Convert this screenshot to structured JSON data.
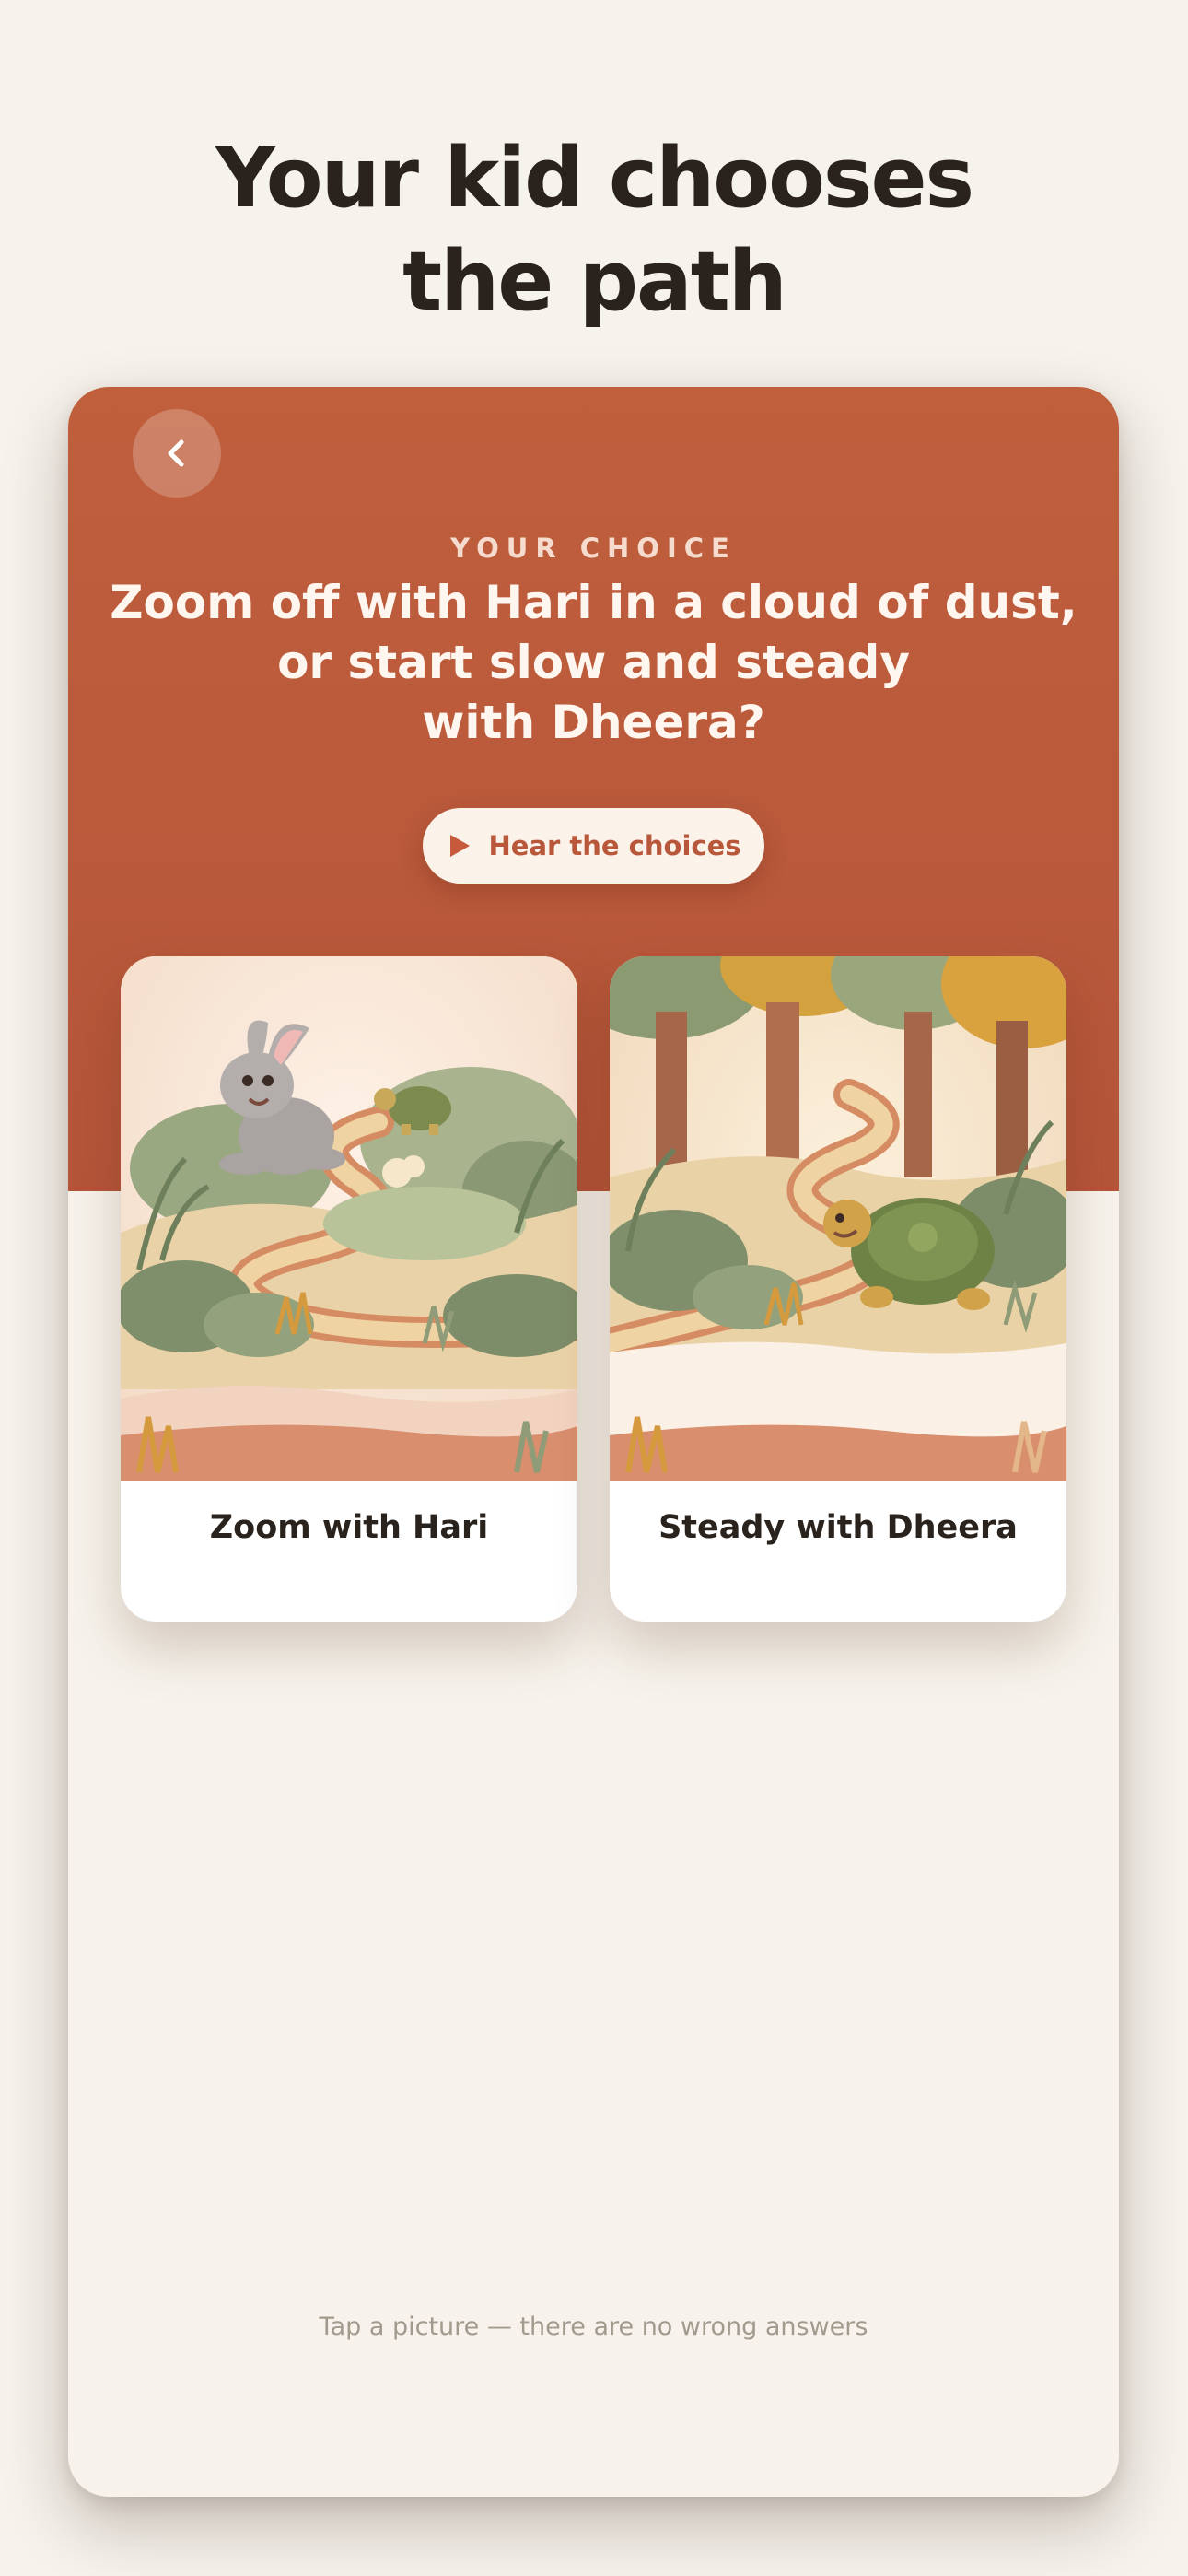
{
  "headline": {
    "line1": "Your kid chooses",
    "line2": "the path"
  },
  "screen": {
    "back_icon": "chevron-left-icon",
    "eyebrow": "YOUR CHOICE",
    "question": {
      "line1": "Zoom off with Hari in a cloud of dust,",
      "line2": "or start slow and steady",
      "line3": "with Dheera?"
    },
    "hear_button": {
      "icon": "play-icon",
      "label": "Hear the choices"
    },
    "choices": [
      {
        "label": "Zoom with Hari",
        "illustration": "rabbit-running-on-path"
      },
      {
        "label": "Steady with Dheera",
        "illustration": "tortoise-walking-on-path"
      }
    ],
    "hint": "Tap a picture — there are no wrong answers"
  },
  "colors": {
    "page_bg": "#f6f2ec",
    "accent": "#c05f3c",
    "text_dark": "#2a231d",
    "hint": "#a39a8e"
  }
}
